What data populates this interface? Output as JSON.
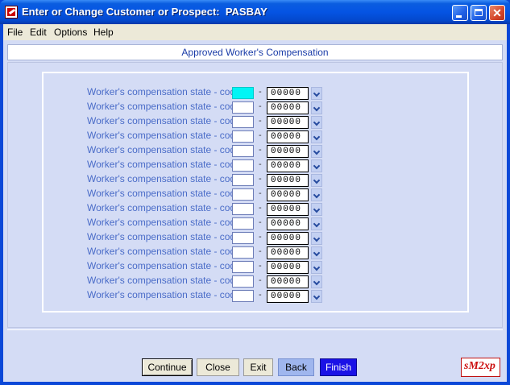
{
  "window": {
    "title": "Enter or Change Customer or Prospect:  PASBAY",
    "close_glyph": "✕"
  },
  "menu": [
    "File",
    "Edit",
    "Options",
    "Help"
  ],
  "header": {
    "title": "Approved Worker's Compensation"
  },
  "rows": [
    {
      "label": "Worker's compensation state - code",
      "state": "",
      "code": "00000"
    },
    {
      "label": "Worker's compensation state - code",
      "state": "",
      "code": "00000"
    },
    {
      "label": "Worker's compensation state - code",
      "state": "",
      "code": "00000"
    },
    {
      "label": "Worker's compensation state - code",
      "state": "",
      "code": "00000"
    },
    {
      "label": "Worker's compensation state - code",
      "state": "",
      "code": "00000"
    },
    {
      "label": "Worker's compensation state - code",
      "state": "",
      "code": "00000"
    },
    {
      "label": "Worker's compensation state - code",
      "state": "",
      "code": "00000"
    },
    {
      "label": "Worker's compensation state - code",
      "state": "",
      "code": "00000"
    },
    {
      "label": "Worker's compensation state - code",
      "state": "",
      "code": "00000"
    },
    {
      "label": "Worker's compensation state - code",
      "state": "",
      "code": "00000"
    },
    {
      "label": "Worker's compensation state - code",
      "state": "",
      "code": "00000"
    },
    {
      "label": "Worker's compensation state - code",
      "state": "",
      "code": "00000"
    },
    {
      "label": "Worker's compensation state - code",
      "state": "",
      "code": "00000"
    },
    {
      "label": "Worker's compensation state - code",
      "state": "",
      "code": "00000"
    },
    {
      "label": "Worker's compensation state - code",
      "state": "",
      "code": "00000"
    }
  ],
  "dash": "-",
  "buttons": {
    "continue": "Continue",
    "close": "Close",
    "exit": "Exit",
    "back": "Back",
    "finish": "Finish"
  },
  "logo": {
    "text": "sM2xp"
  },
  "colors": {
    "active_field": "#00f5f5",
    "label_text": "#4a6cc8",
    "finish_button": "#1a12e6",
    "back_button": "#9fb6ee"
  }
}
